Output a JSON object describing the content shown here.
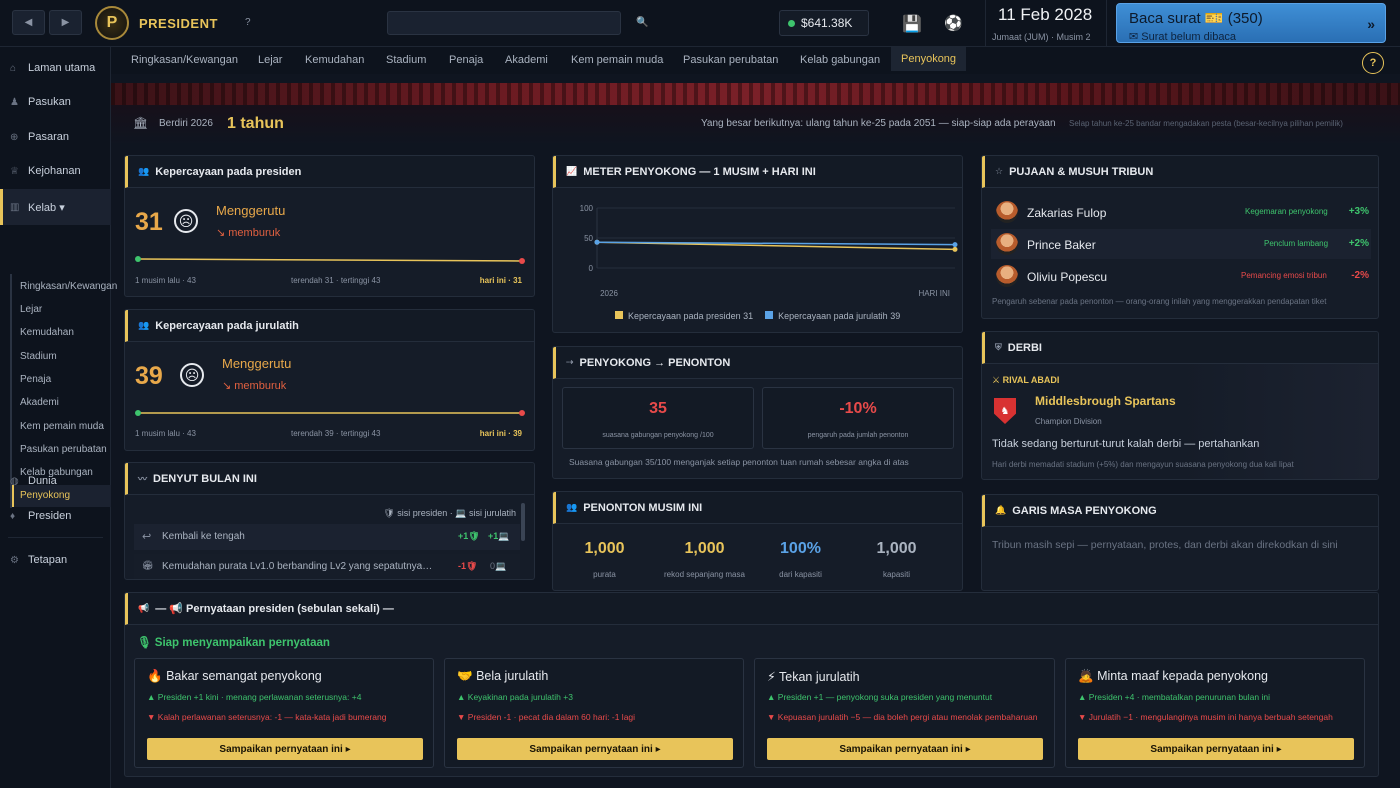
{
  "topbar": {
    "back": "◀",
    "fwd": "▶",
    "logo": "P",
    "brand": "PRESIDENT",
    "help": "?",
    "search_placeholder": "",
    "search_icon": "🔍",
    "money": "$641.38K",
    "save_icon": "💾",
    "ball_icon": "⚽",
    "date": "11 Feb 2028",
    "season": "Jumaat (JUM) · Musim 2",
    "mail_title": "Baca surat 🎫 (350)",
    "mail_sub": "✉ Surat belum dibaca",
    "mail_arrow": "»"
  },
  "sidebar": {
    "items": [
      {
        "icon": "⌂",
        "label": "Laman utama"
      },
      {
        "icon": "♟",
        "label": "Pasukan"
      },
      {
        "icon": "⊕",
        "label": "Pasaran"
      },
      {
        "icon": "♕",
        "label": "Kejohanan"
      },
      {
        "icon": "▥",
        "label": "Kelab ▾"
      },
      {
        "icon": "◍",
        "label": "Dunia"
      },
      {
        "icon": "♦",
        "label": "Presiden"
      },
      {
        "icon": "⚙",
        "label": "Tetapan"
      }
    ],
    "sub": [
      "Ringkasan/Kewangan",
      "Lejar",
      "Kemudahan",
      "Stadium",
      "Penaja",
      "Akademi",
      "Kem pemain muda",
      "Pasukan perubatan",
      "Kelab gabungan",
      "Penyokong"
    ]
  },
  "tabs": [
    "Ringkasan/Kewangan",
    "Lejar",
    "Kemudahan",
    "Stadium",
    "Penaja",
    "Akademi",
    "Kem pemain muda",
    "Pasukan perubatan",
    "Kelab gabungan",
    "Penyokong"
  ],
  "help": "?",
  "founded": {
    "icon": "🏛",
    "label": "Berdiri 2026",
    "years": "1 tahun",
    "next": "Yang besar berikutnya: ulang tahun ke-25 pada 2051 — siap-siap ada perayaan",
    "note": "Selap tahun ke-25 bandar mengadakan pesta (besar-kecilnya pilihan pemilik)"
  },
  "pres": {
    "title": "Kepercayaan pada presiden",
    "value": "31",
    "face": "☹",
    "mood": "Menggerutu",
    "trend": "↘ memburuk",
    "l": "1 musim lalu · 43",
    "m": "terendah 31 · tertinggi 43",
    "r": "hari ini · 31"
  },
  "coach": {
    "title": "Kepercayaan pada jurulatih",
    "value": "39",
    "face": "☹",
    "mood": "Menggerutu",
    "trend": "↘ memburuk",
    "l": "1 musim lalu · 43",
    "m": "terendah 39 · tertinggi 43",
    "r": "hari ini · 39"
  },
  "pulse": {
    "title": "DENYUT BULAN INI",
    "legend": "🛡 sisi presiden · 💻 sisi jurulatih",
    "rows": [
      {
        "icon": "↩",
        "text": "Kembali ke tengah",
        "a": "+1🛡",
        "b": "+1💻"
      },
      {
        "icon": "🏟",
        "text": "Kemudahan purata Lv1.0 berbanding Lv2 yang sepatutnya…",
        "a": "-1🛡",
        "b": "0💻"
      }
    ]
  },
  "meter": {
    "title": "METER PENYOKONG — 1 MUSIM + HARI INI",
    "legend": [
      "Kepercayaan pada presiden 31",
      "Kepercayaan pada jurulatih 39"
    ]
  },
  "chart_data": {
    "type": "line",
    "categories": [
      "2026",
      "HARI INI"
    ],
    "ylim": [
      0,
      100
    ],
    "yticks": [
      "100",
      "50",
      "0"
    ],
    "series": [
      {
        "name": "Kepercayaan pada presiden 31",
        "values": [
          43,
          31
        ],
        "color": "#e8c45a"
      },
      {
        "name": "Kepercayaan pada jurulatih 39",
        "values": [
          43,
          39
        ],
        "color": "#5aa2e6"
      }
    ]
  },
  "conv": {
    "title": "PENYOKONG → PENONTON",
    "v1": "35",
    "l1": "suasana gabungan penyokong /100",
    "v2": "-10%",
    "l2": "pengaruh pada jumlah penonton",
    "note": "Suasana gabungan 35/100 menganjak setiap penonton tuan rumah sebesar angka di atas"
  },
  "att": {
    "title": "PENONTON MUSIM INI",
    "items": [
      {
        "v": "1,000",
        "l": "purata"
      },
      {
        "v": "1,000",
        "l": "rekod sepanjang masa"
      },
      {
        "v": "100%",
        "l": "dari kapasiti"
      },
      {
        "v": "1,000",
        "l": "kapasiti"
      }
    ]
  },
  "idols": {
    "title": "PUJAAN & MUSUH TRIBUN",
    "rows": [
      {
        "name": "Zakarias Fulop",
        "tag": "Kegemaran penyokong",
        "val": "+3%"
      },
      {
        "name": "Prince Baker",
        "tag": "Penclum lambang",
        "val": "+2%"
      },
      {
        "name": "Oliviu Popescu",
        "tag": "Pemancing emosi tribun",
        "val": "-2%"
      }
    ],
    "note": "Pengaruh sebenar pada penonton — orang-orang inilah yang menggerakkan pendapatan tiket"
  },
  "derby": {
    "title": "DERBI",
    "rival_label": "⚔ RIVAL ABADI",
    "rival": "Middlesbrough Spartans",
    "div": "Champion Division",
    "status": "Tidak sedang berturut-turut kalah derbi — pertahankan",
    "note": "Hari derbi memadati stadium (+5%) dan mengayun suasana penyokong dua kali lipat"
  },
  "timeline": {
    "title": "GARIS MASA PENYOKONG",
    "text": "Tribun masih sepi — pernyataan, protes, dan derbi akan direkodkan di sini"
  },
  "statements": {
    "title": "— 📢 Pernyataan presiden (sebulan sekali) —",
    "ready": "🎙 Siap menyampaikan pernyataan",
    "cards": [
      {
        "icon": "🔥",
        "title": "Bakar semangat penyokong",
        "up": "▲ Presiden +1 kini · menang perlawanan seterusnya: +4",
        "down": "▼ Kalah perlawanan seterusnya: -1 — kata-kata jadi bumerang",
        "btn": "Sampaikan pernyataan ini ▸"
      },
      {
        "icon": "🤝",
        "title": "Bela jurulatih",
        "up": "▲ Keyakinan pada jurulatih +3",
        "down": "▼ Presiden -1 · pecat dia dalam 60 hari: -1 lagi",
        "btn": "Sampaikan pernyataan ini ▸"
      },
      {
        "icon": "⚡",
        "title": "Tekan jurulatih",
        "up": "▲ Presiden +1 — penyokong suka presiden yang menuntut",
        "down": "▼ Kepuasan jurulatih −5 — dia boleh pergi atau menolak pembaharuan",
        "btn": "Sampaikan pernyataan ini ▸"
      },
      {
        "icon": "🙇",
        "title": "Minta maaf kepada penyokong",
        "up": "▲ Presiden +4 · membatalkan penurunan bulan ini",
        "down": "▼ Jurulatih −1 · mengulanginya musim ini hanya berbuah setengah",
        "btn": "Sampaikan pernyataan ini ▸"
      }
    ]
  }
}
